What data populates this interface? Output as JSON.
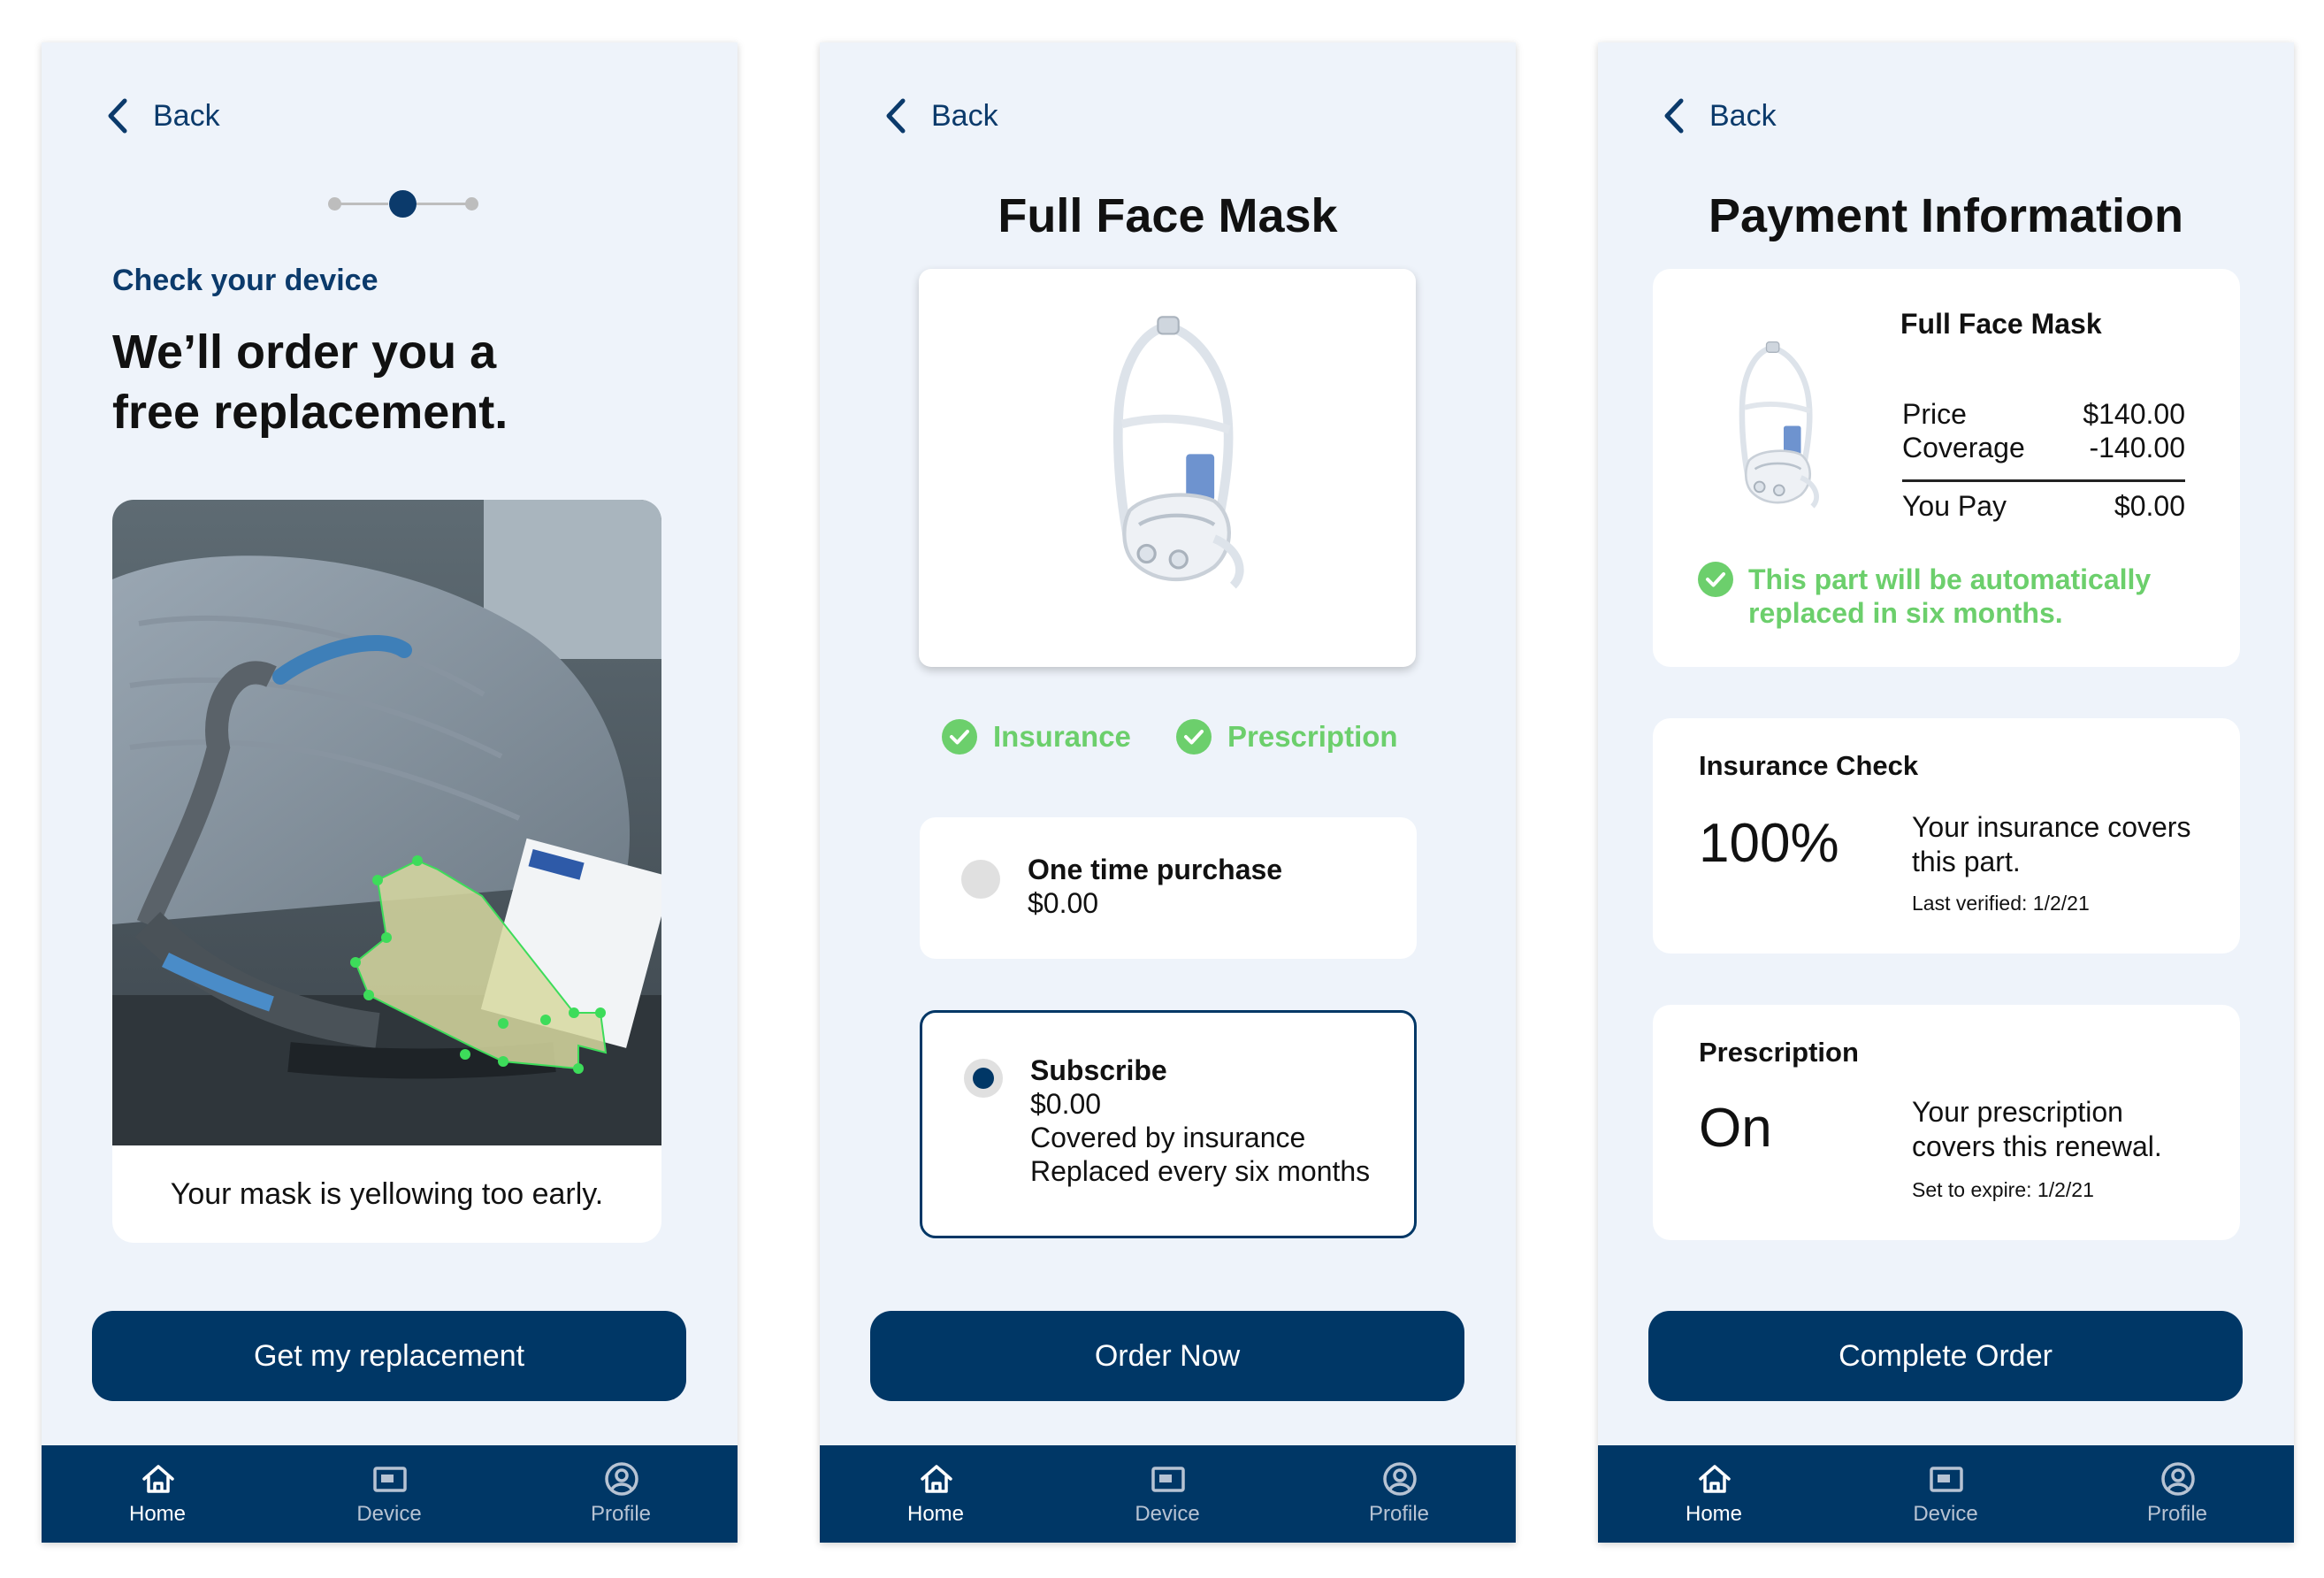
{
  "colors": {
    "navy": "#003766",
    "screen_bg": "#EEF3FA",
    "success_green": "#6CCF6C",
    "nav_inactive": "#B7C3D3"
  },
  "screens": [
    {
      "back_label": "Back",
      "stepper": {
        "current_step": 2,
        "total_steps": 3
      },
      "kicker": "Check your device",
      "headline_line1": "We’ll order you a",
      "headline_line2": "free replacement.",
      "photo_caption": "Your mask is yellowing too early.",
      "cta": "Get my replacement"
    },
    {
      "back_label": "Back",
      "title": "Full Face Mask",
      "checks": [
        {
          "label": "Insurance",
          "icon": "check-circle-icon"
        },
        {
          "label": "Prescription",
          "icon": "check-circle-icon"
        }
      ],
      "options": [
        {
          "title": "One time purchase",
          "price": "$0.00",
          "selected": false
        },
        {
          "title": "Subscribe",
          "price": "$0.00",
          "line3": "Covered by insurance",
          "line4": "Replaced every six months",
          "selected": true
        }
      ],
      "cta": "Order Now"
    },
    {
      "back_label": "Back",
      "title": "Payment Information",
      "summary": {
        "product": "Full Face Mask",
        "price_label": "Price",
        "price_value": "$140.00",
        "coverage_label": "Coverage",
        "coverage_value": "-140.00",
        "pay_label": "You Pay",
        "pay_value": "$0.00",
        "note_line1": "This part will be automatically",
        "note_line2": "replaced in six months."
      },
      "insurance": {
        "title": "Insurance Check",
        "value": "100%",
        "desc_line1": "Your insurance covers",
        "desc_line2": "this part.",
        "verified": "Last verified: 1/2/21"
      },
      "prescription": {
        "title": "Prescription",
        "value": "On",
        "desc_line1": "Your prescription",
        "desc_line2": "covers this renewal.",
        "expire": "Set to expire: 1/2/21"
      },
      "cta": "Complete Order"
    }
  ],
  "nav": {
    "items": [
      {
        "label": "Home",
        "icon": "home-icon",
        "active": true
      },
      {
        "label": "Device",
        "icon": "device-icon",
        "active": false
      },
      {
        "label": "Profile",
        "icon": "profile-icon",
        "active": false
      }
    ]
  }
}
